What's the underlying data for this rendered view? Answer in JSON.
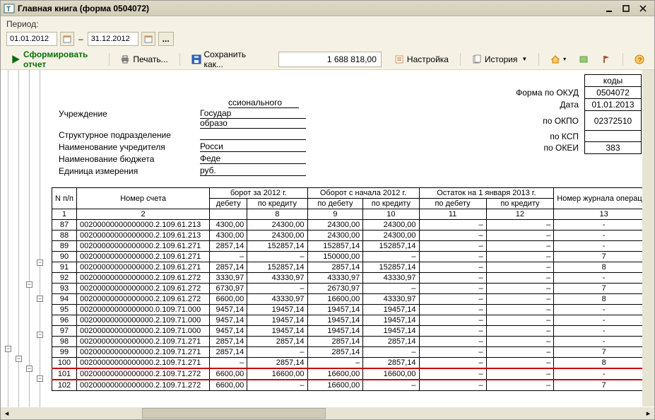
{
  "window": {
    "title": "Главная книга (форма 0504072)",
    "period_label": "Период:",
    "date_from": "01.01.2012",
    "date_to": "31.12.2012",
    "ellipsis": "..."
  },
  "toolbar": {
    "form_report": "Сформировать отчет",
    "print": "Печать...",
    "save_as": "Сохранить как...",
    "amount": "1 688 818,00",
    "settings": "Настройка",
    "history": "История"
  },
  "header": {
    "institution_lbl": "Учреждение",
    "subdiv_lbl": "Структурное подразделение",
    "founder_lbl": "Наименование учредителя",
    "budget_lbl": "Наименование бюджета",
    "unit_lbl": "Единица измерения",
    "institution_val_left": "Государ",
    "institution_val_mid": "ссионального",
    "institution_val_bot": "образо",
    "founder_val": "Росси",
    "budget_val": "Феде",
    "unit_val": "руб.",
    "okud_lbl": "Форма по ОКУД",
    "date_lbl": "Дата",
    "okpo_lbl": "по ОКПО",
    "ksp_lbl": "по КСП",
    "okei_lbl": "по ОКЕИ",
    "codes_head": "коды",
    "okud": "0504072",
    "date": "01.01.2013",
    "okpo": "02372510",
    "ksp": "",
    "okei": "383"
  },
  "thead": {
    "n": "N п/п",
    "acct": "Номер счета",
    "turn_year": "борот за 2012 г.",
    "turn_begin": "Оборот с начала 2012 г.",
    "balance": "Остаток на 1 января 2013 г.",
    "journal": "Номер журнала операций",
    "debit": "по дебету",
    "credit": "по кредиту",
    "debit_cut": "дебету",
    "debit2": "по дебету",
    "credit2": "по кредиту",
    "r1": "1",
    "r2": "2",
    "r8": "8",
    "r9": "9",
    "r10": "10",
    "r11": "11",
    "r12": "12",
    "r13": "13"
  },
  "rows": [
    {
      "n": "87",
      "acct": "00200000000000000.2.109.61.213",
      "d": "4300,00",
      "c": "24300,00",
      "d2": "24300,00",
      "c2": "24300,00",
      "rd": "–",
      "rc": "–",
      "j": "-"
    },
    {
      "n": "88",
      "acct": "00200000000000000.2.109.61.213",
      "d": "4300,00",
      "c": "24300,00",
      "d2": "24300,00",
      "c2": "24300,00",
      "rd": "–",
      "rc": "–",
      "j": "-"
    },
    {
      "n": "89",
      "acct": "00200000000000000.2.109.61.271",
      "d": "2857,14",
      "c": "152857,14",
      "d2": "152857,14",
      "c2": "152857,14",
      "rd": "–",
      "rc": "–",
      "j": "-"
    },
    {
      "n": "90",
      "acct": "00200000000000000.2.109.61.271",
      "d": "–",
      "c": "–",
      "d2": "150000,00",
      "c2": "–",
      "rd": "–",
      "rc": "–",
      "j": "7"
    },
    {
      "n": "91",
      "acct": "00200000000000000.2.109.61.271",
      "d": "2857,14",
      "c": "152857,14",
      "d2": "2857,14",
      "c2": "152857,14",
      "rd": "–",
      "rc": "–",
      "j": "8"
    },
    {
      "n": "92",
      "acct": "00200000000000000.2.109.61.272",
      "d": "3330,97",
      "c": "43330,97",
      "d2": "43330,97",
      "c2": "43330,97",
      "rd": "–",
      "rc": "–",
      "j": "-"
    },
    {
      "n": "93",
      "acct": "00200000000000000.2.109.61.272",
      "d": "6730,97",
      "c": "–",
      "d2": "26730,97",
      "c2": "–",
      "rd": "–",
      "rc": "–",
      "j": "7"
    },
    {
      "n": "94",
      "acct": "00200000000000000.2.109.61.272",
      "d": "6600,00",
      "c": "43330,97",
      "d2": "16600,00",
      "c2": "43330,97",
      "rd": "–",
      "rc": "–",
      "j": "8"
    },
    {
      "n": "95",
      "acct": "00200000000000000.0.109.71.000",
      "d": "9457,14",
      "c": "19457,14",
      "d2": "19457,14",
      "c2": "19457,14",
      "rd": "–",
      "rc": "–",
      "j": "-"
    },
    {
      "n": "96",
      "acct": "00200000000000000.2.109.71.000",
      "d": "9457,14",
      "c": "19457,14",
      "d2": "19457,14",
      "c2": "19457,14",
      "rd": "–",
      "rc": "–",
      "j": "-"
    },
    {
      "n": "97",
      "acct": "00200000000000000.2.109.71.000",
      "d": "9457,14",
      "c": "19457,14",
      "d2": "19457,14",
      "c2": "19457,14",
      "rd": "–",
      "rc": "–",
      "j": "-"
    },
    {
      "n": "98",
      "acct": "00200000000000000.2.109.71.271",
      "d": "2857,14",
      "c": "2857,14",
      "d2": "2857,14",
      "c2": "2857,14",
      "rd": "–",
      "rc": "–",
      "j": "-"
    },
    {
      "n": "99",
      "acct": "00200000000000000.2.109.71.271",
      "d": "2857,14",
      "c": "–",
      "d2": "2857,14",
      "c2": "–",
      "rd": "–",
      "rc": "–",
      "j": "7"
    },
    {
      "n": "100",
      "acct": "00200000000000000.2.109.71.271",
      "d": "–",
      "c": "2857,14",
      "d2": "–",
      "c2": "2857,14",
      "rd": "–",
      "rc": "–",
      "j": "8"
    },
    {
      "n": "101",
      "acct": "00200000000000000.2.109.71.272",
      "d": "6600,00",
      "c": "16600,00",
      "d2": "16600,00",
      "c2": "16600,00",
      "rd": "–",
      "rc": "–",
      "j": "-",
      "hl": true
    },
    {
      "n": "102",
      "acct": "00200000000000000.2.109.71.272",
      "d": "6600,00",
      "c": "–",
      "d2": "16600,00",
      "c2": "–",
      "rd": "–",
      "rc": "–",
      "j": "7"
    }
  ]
}
